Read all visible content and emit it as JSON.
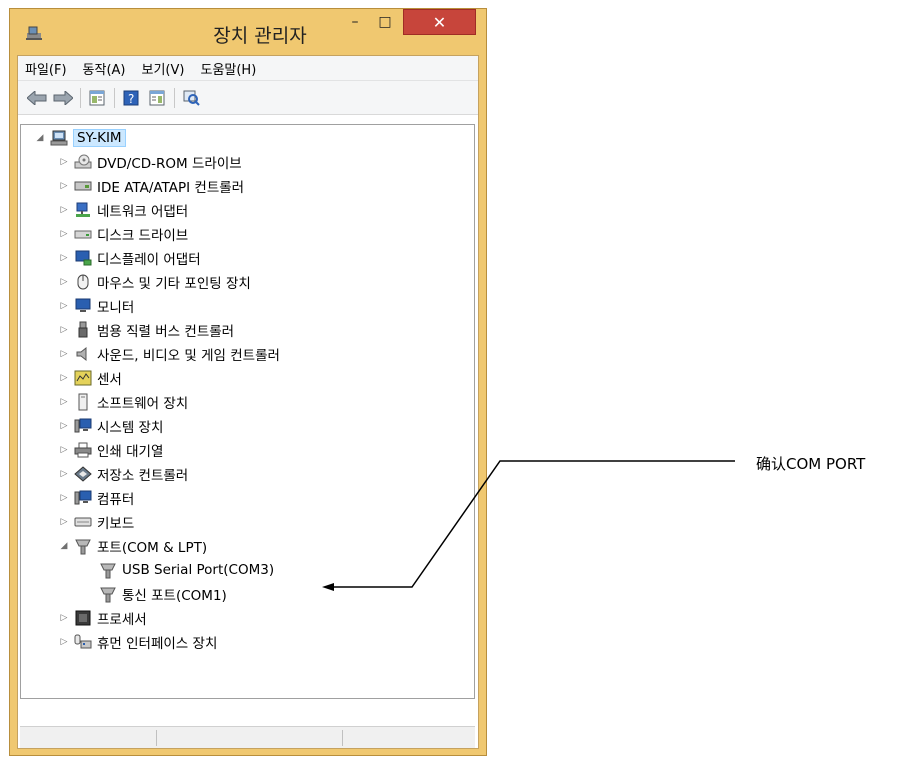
{
  "window": {
    "title": "장치 관리자",
    "buttons": {
      "minimize": "–",
      "maximize": "□",
      "close": "✕"
    }
  },
  "menubar": [
    "파일(F)",
    "동작(A)",
    "보기(V)",
    "도움말(H)"
  ],
  "toolbar": [
    "back-icon",
    "forward-icon",
    "properties-icon",
    "help-icon",
    "view-icon",
    "scan-icon"
  ],
  "tree": {
    "root": "SY-KIM",
    "categories": [
      "DVD/CD-ROM 드라이브",
      "IDE ATA/ATAPI 컨트롤러",
      "네트워크 어댑터",
      "디스크 드라이브",
      "디스플레이 어댑터",
      "마우스 및 기타 포인팅 장치",
      "모니터",
      "범용 직렬 버스 컨트롤러",
      "사운드, 비디오 및 게임 컨트롤러",
      "센서",
      "소프트웨어 장치",
      "시스템 장치",
      "인쇄 대기열",
      "저장소 컨트롤러",
      "컴퓨터",
      "키보드",
      "포트(COM & LPT)",
      "USB Serial Port(COM3)",
      "통신 포트(COM1)",
      "프로세서",
      "휴먼 인터페이스 장치"
    ]
  },
  "annotation": {
    "text": "确认COM PORT"
  },
  "colors": {
    "frame": "#f0c870",
    "close": "#c7453b",
    "selection": "#cce8ff"
  }
}
